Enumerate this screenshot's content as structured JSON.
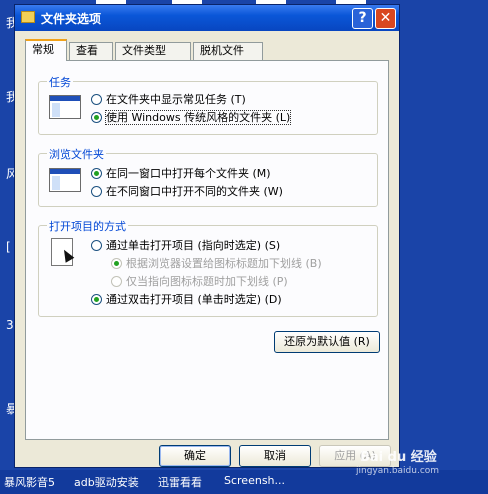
{
  "window": {
    "title": "文件夹选项",
    "help_glyph": "?",
    "close_glyph": "✕"
  },
  "tabs": [
    {
      "label": "常规"
    },
    {
      "label": "查看"
    },
    {
      "label": "文件类型"
    },
    {
      "label": "脱机文件"
    }
  ],
  "groups": {
    "tasks": {
      "label": "任务",
      "options": [
        {
          "label": "在文件夹中显示常见任务 (T)",
          "selected": false
        },
        {
          "label": "使用 Windows 传统风格的文件夹 (L)",
          "selected": true
        }
      ]
    },
    "browse": {
      "label": "浏览文件夹",
      "options": [
        {
          "label": "在同一窗口中打开每个文件夹 (M)",
          "selected": true
        },
        {
          "label": "在不同窗口中打开不同的文件夹 (W)",
          "selected": false
        }
      ]
    },
    "open": {
      "label": "打开项目的方式",
      "options": [
        {
          "label": "通过单击打开项目 (指向时选定) (S)",
          "selected": false
        },
        {
          "label": "根据浏览器设置给图标标题加下划线 (B)",
          "selected": true,
          "disabled": true
        },
        {
          "label": "仅当指向图标标题时加下划线 (P)",
          "selected": false,
          "disabled": true
        },
        {
          "label": "通过双击打开项目 (单击时选定) (D)",
          "selected": true
        }
      ]
    }
  },
  "restore_label": "还原为默认值 (R)",
  "footer": {
    "ok": "确定",
    "cancel": "取消",
    "apply": "应用 (A)"
  },
  "desktop": {
    "left_glyphs": [
      "我",
      "我",
      "风",
      "[",
      "[",
      "3",
      "暴"
    ],
    "taskbar": [
      "暴风影音5",
      "adb驱动安装",
      "迅雷看看",
      "Screensh..."
    ]
  },
  "watermark": {
    "brand": "Bai du 经验",
    "url": "jingyan.baidu.com"
  }
}
